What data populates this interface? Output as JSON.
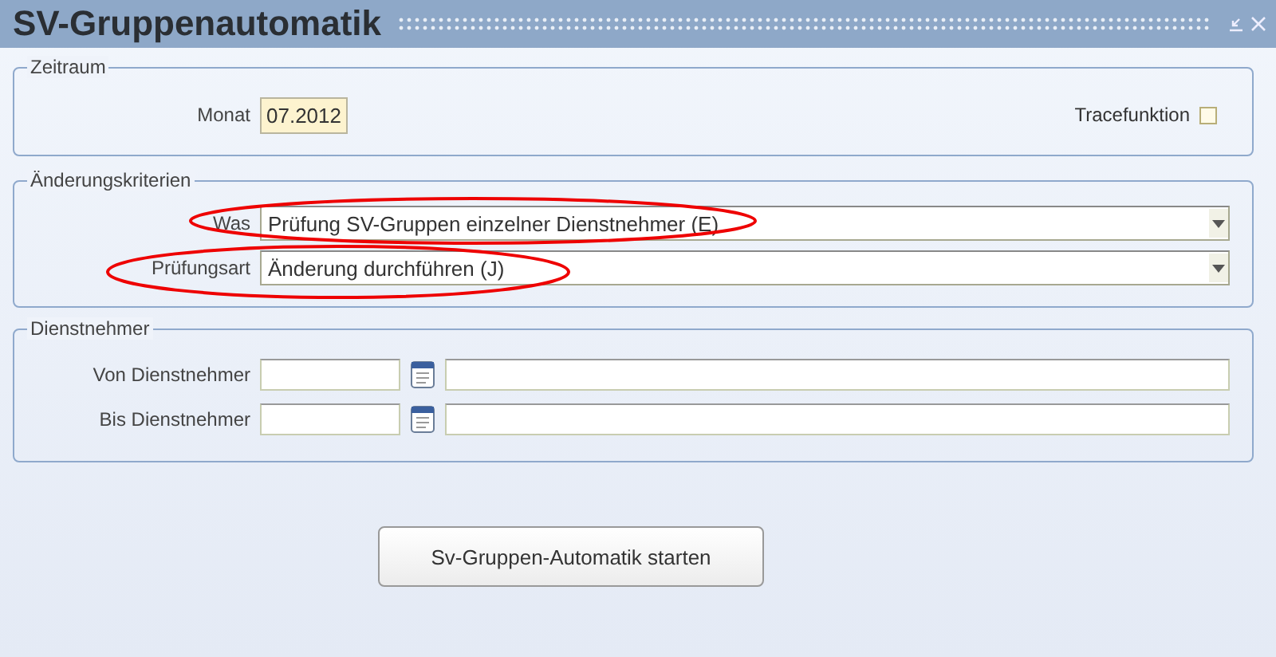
{
  "window": {
    "title": "SV-Gruppenautomatik"
  },
  "zeitraum": {
    "legend": "Zeitraum",
    "month_label": "Monat",
    "month_value": "07.2012",
    "trace_label": "Tracefunktion",
    "trace_checked": false
  },
  "kriterien": {
    "legend": "Änderungskriterien",
    "fields": [
      {
        "label": "Was",
        "value": "Prüfung SV-Gruppen einzelner Dienstnehmer (E)",
        "circled": true
      },
      {
        "label": "Prüfungsart",
        "value": "Änderung durchführen (J)",
        "circled": true
      }
    ]
  },
  "dienstnehmer": {
    "legend": "Dienstnehmer",
    "rows": [
      {
        "label": "Von Dienstnehmer"
      },
      {
        "label": "Bis Dienstnehmer"
      }
    ]
  },
  "start_button": "Sv-Gruppen-Automatik starten"
}
